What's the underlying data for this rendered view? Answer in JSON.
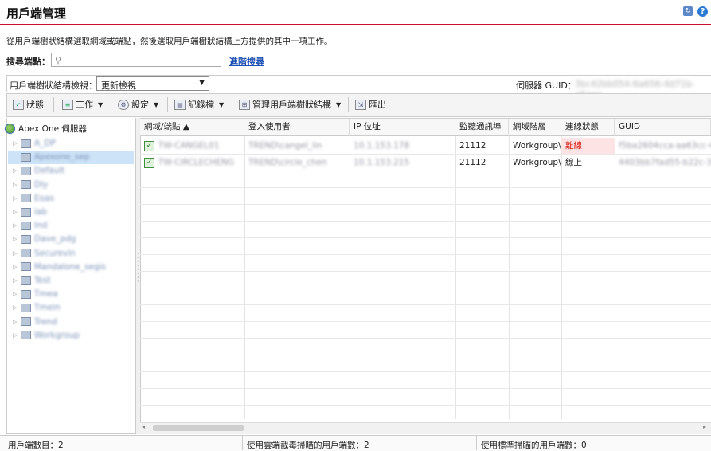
{
  "page": {
    "title": "用戶端管理",
    "description": "從用戶端樹狀結構選取網域或端點，然後選取用戶端樹狀結構上方提供的其中一項工作。",
    "help_icon": "?"
  },
  "search": {
    "label": "搜尋端點：",
    "placeholder": "",
    "advanced_link": "進階搜尋"
  },
  "view": {
    "label": "用戶端樹狀結構檢視：",
    "selected": "更新檢視",
    "server_guid_label": "伺服器 GUID：",
    "server_guid_value": "3bc42bb054-6a656-4d71b-a6aee"
  },
  "toolbar": {
    "status": "狀態",
    "tasks": "工作",
    "settings": "設定",
    "logs": "記錄檔",
    "manage_tree": "管理用戶端樹狀結構",
    "export": "匯出"
  },
  "tree": {
    "root": "Apex One 伺服器",
    "domains": [
      "A_DP",
      "Apexone_sep",
      "Default",
      "Dly",
      "Eoas",
      "lab",
      "Ind",
      "Dave_pdg",
      "Securevin",
      "Mandalone_segis",
      "Test",
      "Tmea",
      "Tmein",
      "Trend",
      "Workgroup"
    ]
  },
  "grid": {
    "columns": [
      "網域/端點 ▲",
      "登入使用者",
      "IP 位址",
      "監聽通訊埠",
      "網域階層",
      "連線狀態",
      "GUID"
    ],
    "rows": [
      {
        "endpoint": "TW-CANGEL01",
        "user": "TREND\\cangel_lin",
        "ip": "10.1.153.178",
        "port": "21112",
        "domain": "Workgroup\\",
        "status": "離線",
        "guid": "f5ba2604cca-aa63cc-4c"
      },
      {
        "endpoint": "TW-CIRCLECHENG",
        "user": "TREND\\circle_chen",
        "ip": "10.1.153.215",
        "port": "21112",
        "domain": "Workgroup\\",
        "status": "線上",
        "guid": "4403bb7fad55-b22c-3"
      }
    ]
  },
  "statusbar": {
    "count": "用戶端數目：2",
    "cloud": "使用雲端截毒掃瞄的用戶端數：2",
    "standard": "使用標準掃瞄的用戶端數：0"
  },
  "colors": {
    "accent": "#c8102e",
    "offline": "#d8150c",
    "selection": "#cde3f7",
    "link": "#1a4fb3"
  }
}
